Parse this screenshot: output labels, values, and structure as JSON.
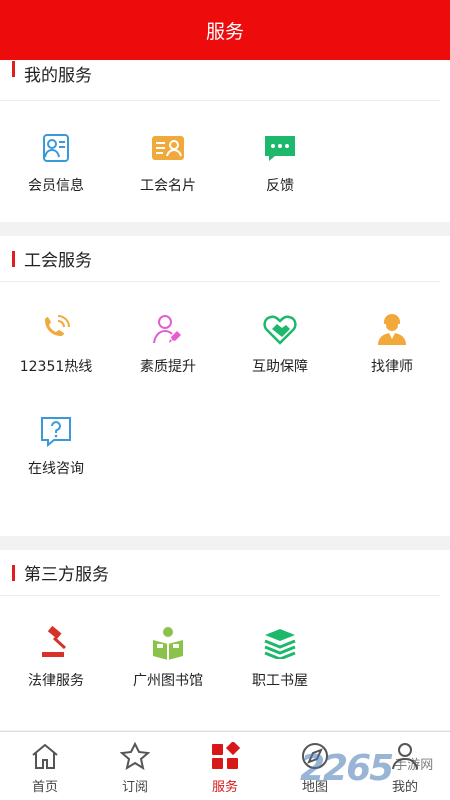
{
  "header": {
    "title": "服务"
  },
  "sections": [
    {
      "title": "我的服务",
      "items": [
        {
          "label": "会员信息",
          "icon": "member-card-icon"
        },
        {
          "label": "工会名片",
          "icon": "business-card-icon"
        },
        {
          "label": "反馈",
          "icon": "chat-bubble-icon"
        }
      ]
    },
    {
      "title": "工会服务",
      "items": [
        {
          "label": "12351热线",
          "icon": "phone-icon"
        },
        {
          "label": "素质提升",
          "icon": "person-rocket-icon"
        },
        {
          "label": "互助保障",
          "icon": "handshake-heart-icon"
        },
        {
          "label": "找律师",
          "icon": "lawyer-icon"
        },
        {
          "label": "在线咨询",
          "icon": "question-icon"
        }
      ]
    },
    {
      "title": "第三方服务",
      "items": [
        {
          "label": "法律服务",
          "icon": "gavel-icon"
        },
        {
          "label": "广州图书馆",
          "icon": "reading-person-icon"
        },
        {
          "label": "职工书屋",
          "icon": "books-stack-icon"
        }
      ]
    }
  ],
  "tabs": [
    {
      "label": "首页",
      "icon": "home-icon"
    },
    {
      "label": "订阅",
      "icon": "star-icon"
    },
    {
      "label": "服务",
      "icon": "services-grid-icon",
      "active": true
    },
    {
      "label": "地图",
      "icon": "compass-icon"
    },
    {
      "label": "我的",
      "icon": "person-icon"
    }
  ],
  "watermark": {
    "number": "2265",
    "text": "手游网"
  },
  "colors": {
    "brand": "#ee0b0b",
    "blue": "#3a9ad9",
    "orange": "#f2a93b",
    "green": "#1db86b",
    "pink": "#e35fd1",
    "red": "#d8312a"
  }
}
